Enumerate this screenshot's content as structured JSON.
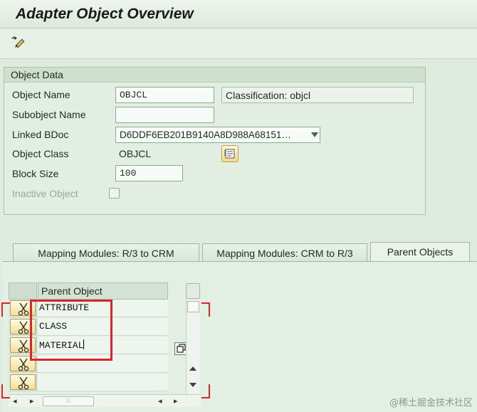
{
  "window": {
    "title": "Adapter Object Overview"
  },
  "toolbar": {
    "edit_icon": "display-change-icon"
  },
  "object_data": {
    "group_title": "Object Data",
    "object_name": {
      "label": "Object Name",
      "value": "OBJCL",
      "description": "Classification: objcl"
    },
    "subobject_name": {
      "label": "Subobject Name",
      "value": ""
    },
    "linked_bdoc": {
      "label": "Linked BDoc",
      "value": "D6DDF6EB201B9140A8D988A68151…"
    },
    "object_class": {
      "label": "Object Class",
      "value": "OBJCL"
    },
    "block_size": {
      "label": "Block Size",
      "value": "100"
    },
    "inactive_object": {
      "label": "Inactive Object",
      "checked": false
    }
  },
  "tabs": [
    {
      "label": "Mapping Modules: R/3 to CRM",
      "active": false
    },
    {
      "label": "Mapping Modules: CRM to R/3",
      "active": false
    },
    {
      "label": "Parent Objects",
      "active": true
    }
  ],
  "parent_table": {
    "header": "Parent Object",
    "rows": [
      "ATTRIBUTE",
      "CLASS",
      "MATERIAL",
      "",
      ""
    ]
  },
  "watermark": "@稀土掘金技术社区",
  "colors": {
    "highlight": "#d8262b",
    "background": "#dfebdf"
  }
}
